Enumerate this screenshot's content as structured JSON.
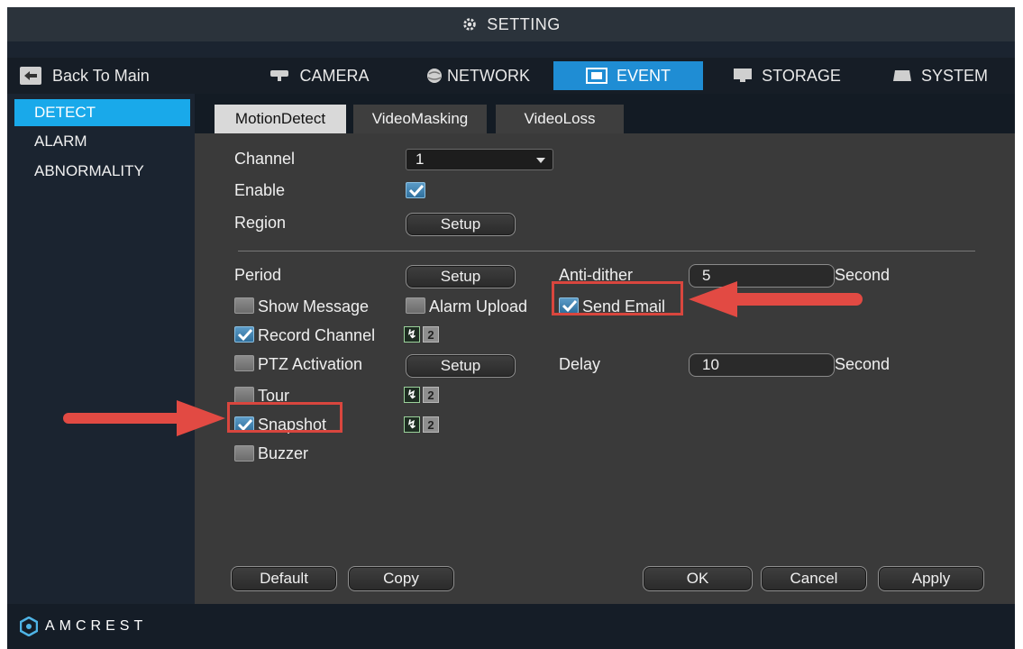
{
  "title": "SETTING",
  "back_label": "Back To Main",
  "top_tabs": [
    {
      "label": "CAMERA",
      "icon": "camera-icon"
    },
    {
      "label": "NETWORK",
      "icon": "globe-icon"
    },
    {
      "label": "EVENT",
      "icon": "event-icon"
    },
    {
      "label": "STORAGE",
      "icon": "monitor-icon"
    },
    {
      "label": "SYSTEM",
      "icon": "system-icon"
    }
  ],
  "sidebar": [
    "DETECT",
    "ALARM",
    "ABNORMALITY"
  ],
  "sub_tabs": [
    "MotionDetect",
    "VideoMasking",
    "VideoLoss"
  ],
  "form": {
    "channel_label": "Channel",
    "channel_value": "1",
    "enable_label": "Enable",
    "region_label": "Region",
    "setup_label": "Setup",
    "period_label": "Period",
    "anti_dither_label": "Anti-dither",
    "anti_dither_value": "5",
    "second_label": "Second",
    "show_message_label": "Show Message",
    "alarm_upload_label": "Alarm Upload",
    "send_email_label": "Send Email",
    "record_channel_label": "Record Channel",
    "ptz_label": "PTZ Activation",
    "delay_label": "Delay",
    "delay_value": "10",
    "tour_label": "Tour",
    "snapshot_label": "Snapshot",
    "buzzer_label": "Buzzer",
    "channel_1_symbol": "↯",
    "channel_2_symbol": "2"
  },
  "buttons": {
    "default": "Default",
    "copy": "Copy",
    "ok": "OK",
    "cancel": "Cancel",
    "apply": "Apply"
  },
  "brand": "AMCREST",
  "colors": {
    "accent": "#1f8dd4",
    "sidebar_active": "#19a9ea",
    "highlight": "#d9463e",
    "arrow": "#e24a43"
  }
}
